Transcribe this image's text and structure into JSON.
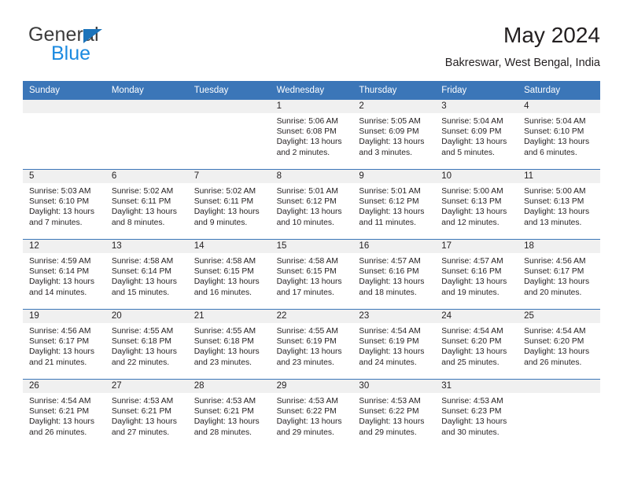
{
  "brand": {
    "name_part1": "General",
    "name_part2": "Blue",
    "triangle_icon": "blue-triangle-icon",
    "colors": {
      "general_text": "#3c3c3c",
      "blue_text": "#1b8ae0",
      "triangle": "#1b73ba"
    }
  },
  "header": {
    "title": "May 2024",
    "subtitle": "Bakreswar, West Bengal, India"
  },
  "theme": {
    "header_blue": "#3b76b8",
    "day_band_gray": "#f0f0f0",
    "text": "#231f20"
  },
  "weekdays": [
    "Sunday",
    "Monday",
    "Tuesday",
    "Wednesday",
    "Thursday",
    "Friday",
    "Saturday"
  ],
  "weeks": [
    [
      {
        "day": "",
        "empty": true,
        "sunrise": "",
        "sunset": "",
        "daylight_line1": "",
        "daylight_line2": ""
      },
      {
        "day": "",
        "empty": true,
        "sunrise": "",
        "sunset": "",
        "daylight_line1": "",
        "daylight_line2": ""
      },
      {
        "day": "",
        "empty": true,
        "sunrise": "",
        "sunset": "",
        "daylight_line1": "",
        "daylight_line2": ""
      },
      {
        "day": "1",
        "empty": false,
        "sunrise": "Sunrise: 5:06 AM",
        "sunset": "Sunset: 6:08 PM",
        "daylight_line1": "Daylight: 13 hours",
        "daylight_line2": "and 2 minutes."
      },
      {
        "day": "2",
        "empty": false,
        "sunrise": "Sunrise: 5:05 AM",
        "sunset": "Sunset: 6:09 PM",
        "daylight_line1": "Daylight: 13 hours",
        "daylight_line2": "and 3 minutes."
      },
      {
        "day": "3",
        "empty": false,
        "sunrise": "Sunrise: 5:04 AM",
        "sunset": "Sunset: 6:09 PM",
        "daylight_line1": "Daylight: 13 hours",
        "daylight_line2": "and 5 minutes."
      },
      {
        "day": "4",
        "empty": false,
        "sunrise": "Sunrise: 5:04 AM",
        "sunset": "Sunset: 6:10 PM",
        "daylight_line1": "Daylight: 13 hours",
        "daylight_line2": "and 6 minutes."
      }
    ],
    [
      {
        "day": "5",
        "empty": false,
        "sunrise": "Sunrise: 5:03 AM",
        "sunset": "Sunset: 6:10 PM",
        "daylight_line1": "Daylight: 13 hours",
        "daylight_line2": "and 7 minutes."
      },
      {
        "day": "6",
        "empty": false,
        "sunrise": "Sunrise: 5:02 AM",
        "sunset": "Sunset: 6:11 PM",
        "daylight_line1": "Daylight: 13 hours",
        "daylight_line2": "and 8 minutes."
      },
      {
        "day": "7",
        "empty": false,
        "sunrise": "Sunrise: 5:02 AM",
        "sunset": "Sunset: 6:11 PM",
        "daylight_line1": "Daylight: 13 hours",
        "daylight_line2": "and 9 minutes."
      },
      {
        "day": "8",
        "empty": false,
        "sunrise": "Sunrise: 5:01 AM",
        "sunset": "Sunset: 6:12 PM",
        "daylight_line1": "Daylight: 13 hours",
        "daylight_line2": "and 10 minutes."
      },
      {
        "day": "9",
        "empty": false,
        "sunrise": "Sunrise: 5:01 AM",
        "sunset": "Sunset: 6:12 PM",
        "daylight_line1": "Daylight: 13 hours",
        "daylight_line2": "and 11 minutes."
      },
      {
        "day": "10",
        "empty": false,
        "sunrise": "Sunrise: 5:00 AM",
        "sunset": "Sunset: 6:13 PM",
        "daylight_line1": "Daylight: 13 hours",
        "daylight_line2": "and 12 minutes."
      },
      {
        "day": "11",
        "empty": false,
        "sunrise": "Sunrise: 5:00 AM",
        "sunset": "Sunset: 6:13 PM",
        "daylight_line1": "Daylight: 13 hours",
        "daylight_line2": "and 13 minutes."
      }
    ],
    [
      {
        "day": "12",
        "empty": false,
        "sunrise": "Sunrise: 4:59 AM",
        "sunset": "Sunset: 6:14 PM",
        "daylight_line1": "Daylight: 13 hours",
        "daylight_line2": "and 14 minutes."
      },
      {
        "day": "13",
        "empty": false,
        "sunrise": "Sunrise: 4:58 AM",
        "sunset": "Sunset: 6:14 PM",
        "daylight_line1": "Daylight: 13 hours",
        "daylight_line2": "and 15 minutes."
      },
      {
        "day": "14",
        "empty": false,
        "sunrise": "Sunrise: 4:58 AM",
        "sunset": "Sunset: 6:15 PM",
        "daylight_line1": "Daylight: 13 hours",
        "daylight_line2": "and 16 minutes."
      },
      {
        "day": "15",
        "empty": false,
        "sunrise": "Sunrise: 4:58 AM",
        "sunset": "Sunset: 6:15 PM",
        "daylight_line1": "Daylight: 13 hours",
        "daylight_line2": "and 17 minutes."
      },
      {
        "day": "16",
        "empty": false,
        "sunrise": "Sunrise: 4:57 AM",
        "sunset": "Sunset: 6:16 PM",
        "daylight_line1": "Daylight: 13 hours",
        "daylight_line2": "and 18 minutes."
      },
      {
        "day": "17",
        "empty": false,
        "sunrise": "Sunrise: 4:57 AM",
        "sunset": "Sunset: 6:16 PM",
        "daylight_line1": "Daylight: 13 hours",
        "daylight_line2": "and 19 minutes."
      },
      {
        "day": "18",
        "empty": false,
        "sunrise": "Sunrise: 4:56 AM",
        "sunset": "Sunset: 6:17 PM",
        "daylight_line1": "Daylight: 13 hours",
        "daylight_line2": "and 20 minutes."
      }
    ],
    [
      {
        "day": "19",
        "empty": false,
        "sunrise": "Sunrise: 4:56 AM",
        "sunset": "Sunset: 6:17 PM",
        "daylight_line1": "Daylight: 13 hours",
        "daylight_line2": "and 21 minutes."
      },
      {
        "day": "20",
        "empty": false,
        "sunrise": "Sunrise: 4:55 AM",
        "sunset": "Sunset: 6:18 PM",
        "daylight_line1": "Daylight: 13 hours",
        "daylight_line2": "and 22 minutes."
      },
      {
        "day": "21",
        "empty": false,
        "sunrise": "Sunrise: 4:55 AM",
        "sunset": "Sunset: 6:18 PM",
        "daylight_line1": "Daylight: 13 hours",
        "daylight_line2": "and 23 minutes."
      },
      {
        "day": "22",
        "empty": false,
        "sunrise": "Sunrise: 4:55 AM",
        "sunset": "Sunset: 6:19 PM",
        "daylight_line1": "Daylight: 13 hours",
        "daylight_line2": "and 23 minutes."
      },
      {
        "day": "23",
        "empty": false,
        "sunrise": "Sunrise: 4:54 AM",
        "sunset": "Sunset: 6:19 PM",
        "daylight_line1": "Daylight: 13 hours",
        "daylight_line2": "and 24 minutes."
      },
      {
        "day": "24",
        "empty": false,
        "sunrise": "Sunrise: 4:54 AM",
        "sunset": "Sunset: 6:20 PM",
        "daylight_line1": "Daylight: 13 hours",
        "daylight_line2": "and 25 minutes."
      },
      {
        "day": "25",
        "empty": false,
        "sunrise": "Sunrise: 4:54 AM",
        "sunset": "Sunset: 6:20 PM",
        "daylight_line1": "Daylight: 13 hours",
        "daylight_line2": "and 26 minutes."
      }
    ],
    [
      {
        "day": "26",
        "empty": false,
        "sunrise": "Sunrise: 4:54 AM",
        "sunset": "Sunset: 6:21 PM",
        "daylight_line1": "Daylight: 13 hours",
        "daylight_line2": "and 26 minutes."
      },
      {
        "day": "27",
        "empty": false,
        "sunrise": "Sunrise: 4:53 AM",
        "sunset": "Sunset: 6:21 PM",
        "daylight_line1": "Daylight: 13 hours",
        "daylight_line2": "and 27 minutes."
      },
      {
        "day": "28",
        "empty": false,
        "sunrise": "Sunrise: 4:53 AM",
        "sunset": "Sunset: 6:21 PM",
        "daylight_line1": "Daylight: 13 hours",
        "daylight_line2": "and 28 minutes."
      },
      {
        "day": "29",
        "empty": false,
        "sunrise": "Sunrise: 4:53 AM",
        "sunset": "Sunset: 6:22 PM",
        "daylight_line1": "Daylight: 13 hours",
        "daylight_line2": "and 29 minutes."
      },
      {
        "day": "30",
        "empty": false,
        "sunrise": "Sunrise: 4:53 AM",
        "sunset": "Sunset: 6:22 PM",
        "daylight_line1": "Daylight: 13 hours",
        "daylight_line2": "and 29 minutes."
      },
      {
        "day": "31",
        "empty": false,
        "sunrise": "Sunrise: 4:53 AM",
        "sunset": "Sunset: 6:23 PM",
        "daylight_line1": "Daylight: 13 hours",
        "daylight_line2": "and 30 minutes."
      },
      {
        "day": "",
        "empty": true,
        "sunrise": "",
        "sunset": "",
        "daylight_line1": "",
        "daylight_line2": ""
      }
    ]
  ]
}
